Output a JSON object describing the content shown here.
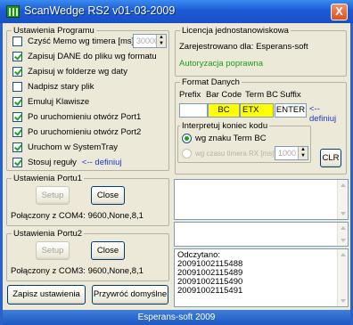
{
  "window": {
    "title": "ScanWedge RS2 v01-03-2009",
    "close_glyph": "X"
  },
  "settings": {
    "legend": "Ustawienia Programu",
    "clear_memo": {
      "label": "Czyść Memo wg timera [ms]",
      "checked": false,
      "value": "30000"
    },
    "save_data": {
      "label": "Zapisuj DANE do pliku wg formatu",
      "checked": true
    },
    "save_folder": {
      "label": "Zapisuj w folderze wg daty",
      "checked": true
    },
    "overwrite": {
      "label": "Nadpisz stary plik",
      "checked": false
    },
    "emulate_keys": {
      "label": "Emuluj Klawisze",
      "checked": true
    },
    "open_port1": {
      "label": "Po uruchomieniu otwórz Port1",
      "checked": true
    },
    "open_port2": {
      "label": "Po uruchomieniu otwórz Port2",
      "checked": true
    },
    "systray": {
      "label": "Uruchom w SystemTray",
      "checked": true
    },
    "rules": {
      "label": "Stosuj reguły",
      "checked": true,
      "link": "<-- definiuj"
    }
  },
  "port1": {
    "legend": "Ustawienia Portu1",
    "setup_label": "Setup",
    "close_label": "Close",
    "status": "Połączony z COM4: 9600,None,8,1"
  },
  "port2": {
    "legend": "Ustawienia Portu2",
    "setup_label": "Setup",
    "close_label": "Close",
    "status": "Połączony z COM3: 9600,None,8,1"
  },
  "buttons": {
    "save": "Zapisz ustawienia",
    "restore": "Przywróć domyślne"
  },
  "license": {
    "legend": "Licencja jednostanowiskowa",
    "registered": "Zarejestrowano dla: Esperans-soft",
    "authorized": "Autoryzacja poprawna"
  },
  "format": {
    "legend": "Format Danych",
    "col_prefix": "Prefix",
    "col_barcode": "Bar Code",
    "col_term": "Term BC",
    "col_suffix": "Suffix",
    "prefix_value": "",
    "barcode_value": "BC",
    "term_value": "ETX",
    "suffix_value": "ENTER",
    "link": "<-- definiuj"
  },
  "interpret": {
    "legend": "Interpretuj koniec kodu",
    "option1": "wg znaku Term BC",
    "option2": "wg czasu timera RX [ms]",
    "timer_value": "1000",
    "clr_label": "CLR"
  },
  "log": {
    "header": "Odczytano:",
    "lines": [
      "20091002115488",
      "20091002115489",
      "20091002115490",
      "20091002115491"
    ]
  },
  "status_bar": "Esperans-soft 2009",
  "colors": {
    "titlebar": "#1c5bd6",
    "face": "#ece9d8",
    "authorized": "#1a9c1a",
    "link": "#1d38c9",
    "highlight": "#ffff00"
  }
}
